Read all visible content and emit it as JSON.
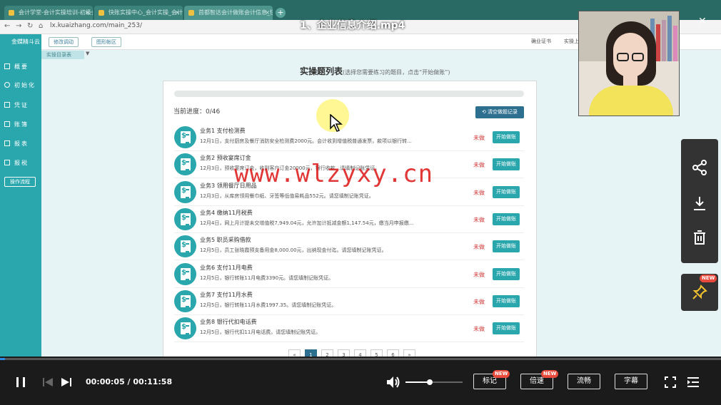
{
  "browser": {
    "tabs": [
      "会计学堂-会计实操培训-初级会",
      "快账实操中心_会计实操_会计教",
      "首都智达会计做账会计信息_快账"
    ],
    "url": "lx.kuaizhang.com/main_253/"
  },
  "app": {
    "logo_text": "金蝶精斗云",
    "header_buttons": [
      "修改调动",
      "图形帐区"
    ],
    "header_right": [
      "确业证书",
      "实操上"
    ],
    "sidebar": [
      {
        "label": "概要",
        "icon": "overview-icon"
      },
      {
        "label": "初始化",
        "icon": "settings-icon"
      },
      {
        "label": "凭证",
        "icon": "voucher-icon"
      },
      {
        "label": "账簿",
        "icon": "ledger-icon"
      },
      {
        "label": "报表",
        "icon": "report-icon"
      },
      {
        "label": "报税",
        "icon": "tax-icon"
      }
    ],
    "op_flow": "操作流程",
    "subtab": "实操目录表"
  },
  "page": {
    "title": "实操题列表",
    "subtitle": "(选择您需要练习的题目，点击“开始做账”)",
    "progress_label": "当前进度：0/46",
    "progress": 0,
    "clear_button": "清空做题记录",
    "rows": [
      {
        "title": "业务1 支付检测费",
        "desc": "12月1日，支付厨房及餐厅消防安全检测费2000元。会计收到增值税普通发票，款项以银行转...",
        "status": "未做",
        "action": "开始做账"
      },
      {
        "title": "业务2 预收宴席订金",
        "desc": "12月3日，预收宴席订金，收到客户订金20000元，银行收款...请填制记账凭证。",
        "status": "未做",
        "action": "开始做账"
      },
      {
        "title": "业务3 领用餐厅日用品",
        "desc": "12月3日，从库房领用餐巾纸、牙签等低值易耗品552元。请您填制记账凭证。",
        "status": "未做",
        "action": "开始做账"
      },
      {
        "title": "业务4 缴纳11月税费",
        "desc": "12月4日，网上月计提未交增值税7,949.04元，允许加计抵减金额1,147.54元，缴当月申报缴...",
        "status": "未做",
        "action": "开始做账"
      },
      {
        "title": "业务5 职员采购借款",
        "desc": "12月5日，员工张晓霞预支备用金8,000.00元，出纳现金付迄。请您填制记账凭证。",
        "status": "未做",
        "action": "开始做账"
      },
      {
        "title": "业务6 支付11月电费",
        "desc": "12月5日，银行转账11月电费3390元。请您填制记账凭证。",
        "status": "未做",
        "action": "开始做账"
      },
      {
        "title": "业务7 支付11月水费",
        "desc": "12月5日，银行转账11月水费1997.35。请您填制记账凭证。",
        "status": "未做",
        "action": "开始做账"
      },
      {
        "title": "业务8 银行代扣电话费",
        "desc": "12月5日，银行代扣11月电话费。请您填制记账凭证。",
        "status": "未做",
        "action": "开始做账"
      }
    ],
    "pager": [
      "«",
      "1",
      "2",
      "3",
      "4",
      "5",
      "6",
      "»"
    ],
    "pager_active": "1"
  },
  "overlay": {
    "watermark": "www.wlzyxy.cn",
    "video_title": "1、企业信息介绍.mp4"
  },
  "player": {
    "time": "00:00:05 / 00:11:58",
    "seek_progress": 0.007,
    "volume": 0.42,
    "buttons": [
      "标记",
      "倍速",
      "流畅",
      "字幕"
    ],
    "new_badge": "NEW"
  },
  "side_actions": [
    "share-icon",
    "download-icon",
    "delete-icon",
    "pin-icon"
  ]
}
